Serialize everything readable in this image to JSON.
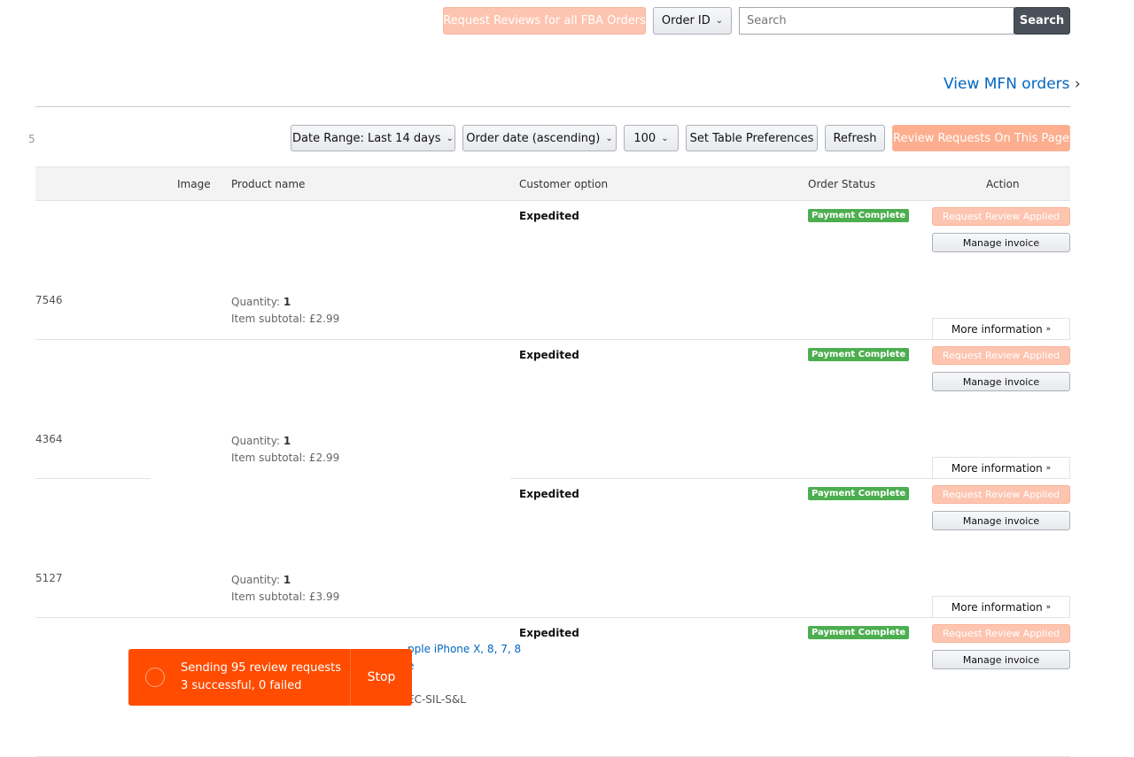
{
  "top": {
    "request_all_label": "Request Reviews for all FBA Orders",
    "search_type": "Order ID",
    "search_placeholder": "Search",
    "search_button": "Search",
    "view_mfn": "View MFN orders"
  },
  "toolbar": {
    "truncated_count": "5",
    "date_range": "Date Range: Last 14 days",
    "sort": "Order date (ascending)",
    "per_page": "100",
    "table_prefs": "Set Table Preferences",
    "refresh": "Refresh",
    "review_page": "Review Requests On This Page"
  },
  "table": {
    "headers": {
      "image": "Image",
      "product": "Product name",
      "customer_option": "Customer option",
      "status": "Order Status",
      "action": "Action"
    },
    "rows": [
      {
        "order_id_fragment": "7546",
        "quantity_label": "Quantity:",
        "quantity": "1",
        "subtotal": "Item subtotal: £2.99",
        "customer_option": "Expedited",
        "status": "Payment Complete",
        "review_button": "Request Review Applied",
        "invoice_button": "Manage invoice",
        "more": "More information"
      },
      {
        "order_id_fragment": "4364",
        "quantity_label": "Quantity:",
        "quantity": "1",
        "subtotal": "Item subtotal: £2.99",
        "customer_option": "Expedited",
        "status": "Payment Complete",
        "review_button": "Request Review Applied",
        "invoice_button": "Manage invoice",
        "more": "More information"
      },
      {
        "order_id_fragment": "5127",
        "quantity_label": "Quantity:",
        "quantity": "1",
        "subtotal": "Item subtotal: £3.99",
        "customer_option": "Expedited",
        "status": "Payment Complete",
        "review_button": "Request Review Applied",
        "invoice_button": "Manage invoice",
        "more": "More information"
      },
      {
        "customer_option": "Expedited",
        "status": "Payment Complete",
        "review_button": "Request Review Applied",
        "invoice_button": "Manage invoice",
        "product_fragment_1": "pple iPhone X, 8, 7, 8",
        "product_fragment_2": "e",
        "sku_fragment": "EC-SIL-S&L"
      }
    ]
  },
  "toast": {
    "line1": "Sending 95 review requests",
    "line2": "3 successful, 0 failed",
    "stop": "Stop",
    "color": "#ff4c00"
  }
}
